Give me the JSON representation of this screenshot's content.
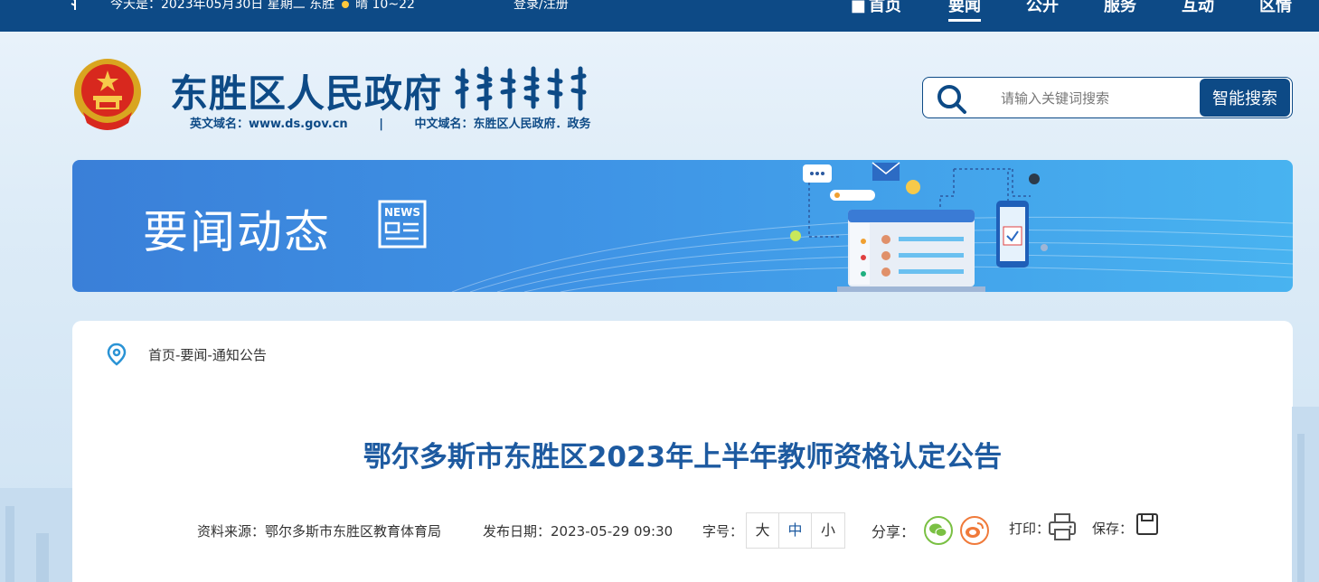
{
  "topbar": {
    "date_text": "今天是：2023年05月30日 星期二   东胜",
    "weather_text": "晴 10~22",
    "login_text": "登录/注册",
    "nav": [
      {
        "label": "首页"
      },
      {
        "label": "要闻"
      },
      {
        "label": "公开"
      },
      {
        "label": "服务"
      },
      {
        "label": "互动"
      },
      {
        "label": "区情"
      }
    ],
    "active_nav": "要闻"
  },
  "header": {
    "site_title": "东胜区人民政府",
    "en_domain": "英文域名：www.ds.gov.cn",
    "separator": "|",
    "cn_domain": "中文域名：东胜区人民政府．政务"
  },
  "search": {
    "placeholder": "请输入关键词搜索",
    "button_label": "智能搜索"
  },
  "banner": {
    "title": "要闻动态",
    "icon_text": "NEWS"
  },
  "breadcrumb": "首页-要闻-通知公告",
  "article": {
    "title": "鄂尔多斯市东胜区2023年上半年教师资格认定公告",
    "source_label": "资料来源：",
    "source": "鄂尔多斯市东胜区教育体育局",
    "date_label": "发布日期：",
    "date": "2023-05-29 09:30",
    "fontsize_label": "字号：",
    "fontsizes": [
      "大",
      "中",
      "小"
    ],
    "selected_fontsize": "中",
    "share_label": "分享：",
    "print_label": "打印：",
    "save_label": "保存："
  },
  "colors": {
    "primary": "#0d4a86",
    "title_blue": "#1d5aa0",
    "banner_blue": "#3f95e6",
    "wechat_green": "#7ac043",
    "weibo_orange": "#f07a3a"
  }
}
